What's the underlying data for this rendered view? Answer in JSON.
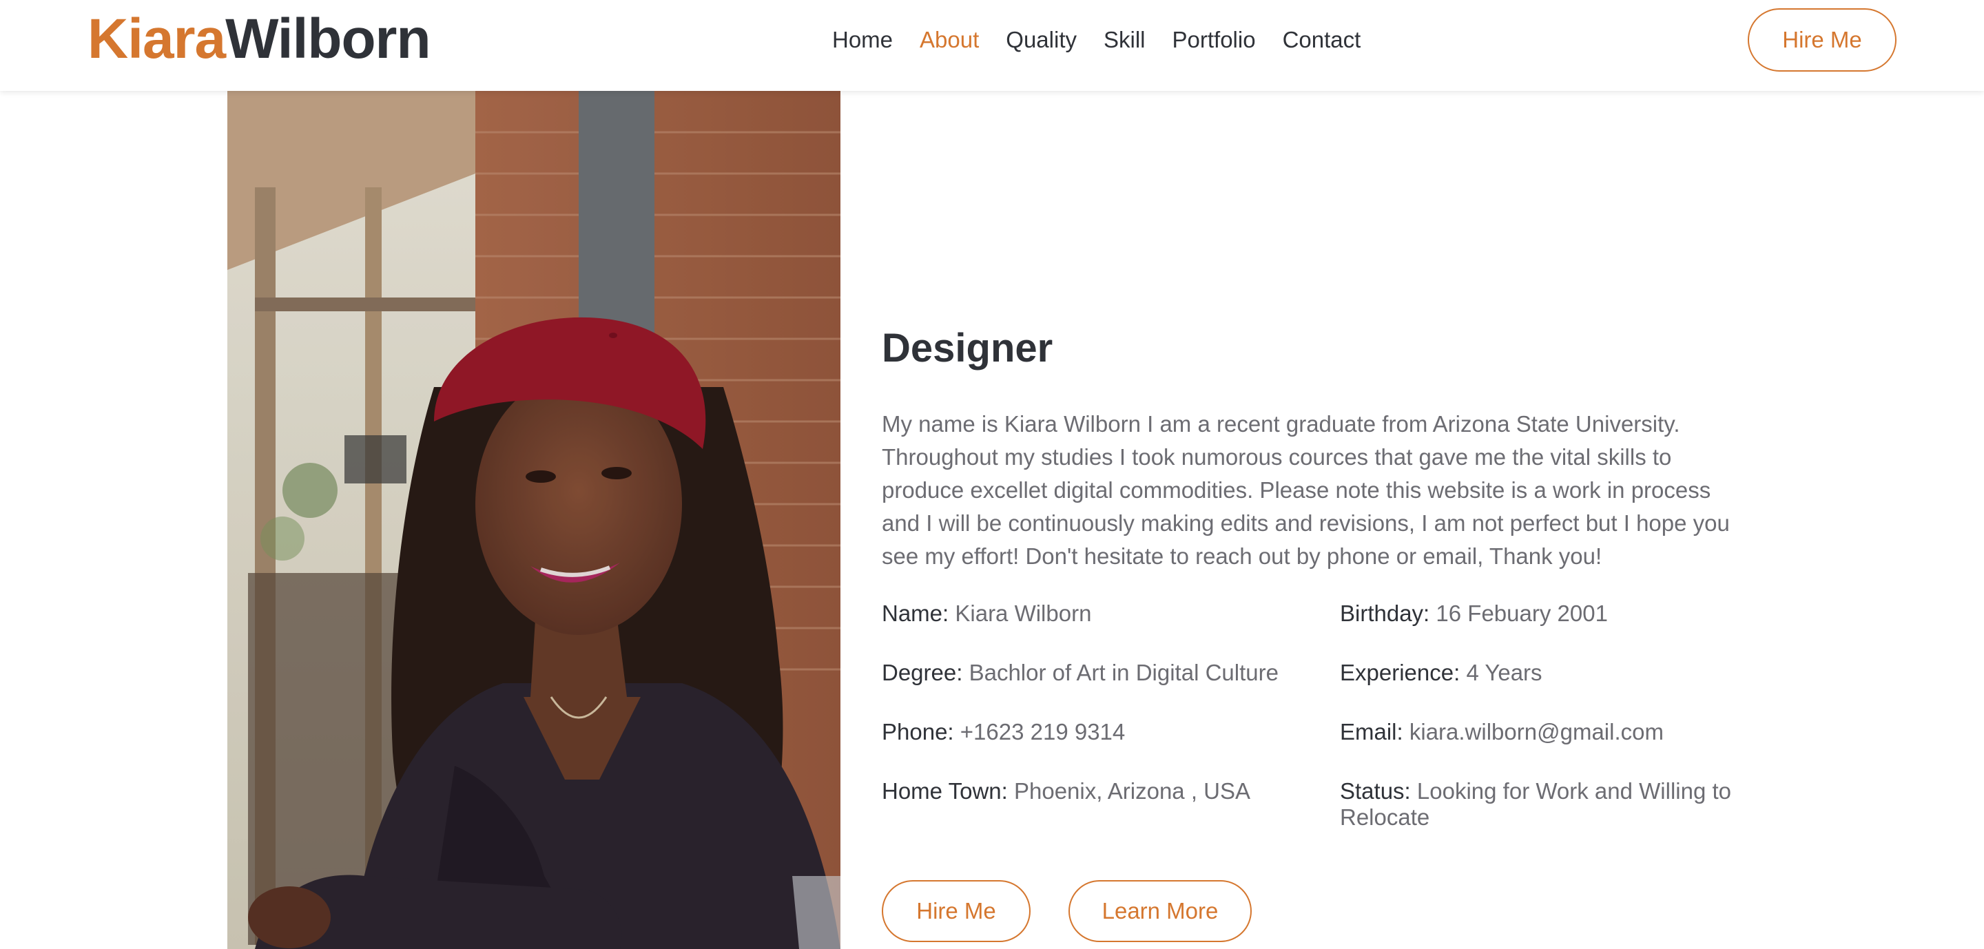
{
  "header": {
    "logo_first": "Kiara",
    "logo_last": "Wilborn",
    "nav": [
      {
        "label": "Home",
        "active": false
      },
      {
        "label": "About",
        "active": true
      },
      {
        "label": "Quality",
        "active": false
      },
      {
        "label": "Skill",
        "active": false
      },
      {
        "label": "Portfolio",
        "active": false
      },
      {
        "label": "Contact",
        "active": false
      }
    ],
    "hire_label": "Hire Me"
  },
  "about": {
    "title": "Designer",
    "bio": "My name is Kiara Wilborn I am a recent graduate from Arizona State University. Throughout my studies I took numorous cources that gave me the vital skills to produce excellet digital commodities. Please note this website is a work in process and I will be continuously making edits and revisions, I am not perfect but I hope you see my effort! Don't hesitate to reach out by phone or email, Thank you!",
    "info": [
      {
        "label": "Name:",
        "value": "Kiara Wilborn"
      },
      {
        "label": "Birthday:",
        "value": "16 Febuary 2001"
      },
      {
        "label": "Degree:",
        "value": "Bachlor of Art in Digital Culture"
      },
      {
        "label": "Experience:",
        "value": "4 Years"
      },
      {
        "label": "Phone:",
        "value": "+1623 219 9314"
      },
      {
        "label": "Email:",
        "value": "kiara.wilborn@gmail.com"
      },
      {
        "label": "Home Town:",
        "value": "Phoenix, Arizona , USA"
      },
      {
        "label": "Status:",
        "value": "Looking for Work and Willing to Relocate"
      }
    ],
    "buttons": {
      "hire": "Hire Me",
      "learn": "Learn More"
    }
  },
  "colors": {
    "accent": "#d5772f",
    "heading": "#2f3238",
    "body": "#6c6c72"
  }
}
